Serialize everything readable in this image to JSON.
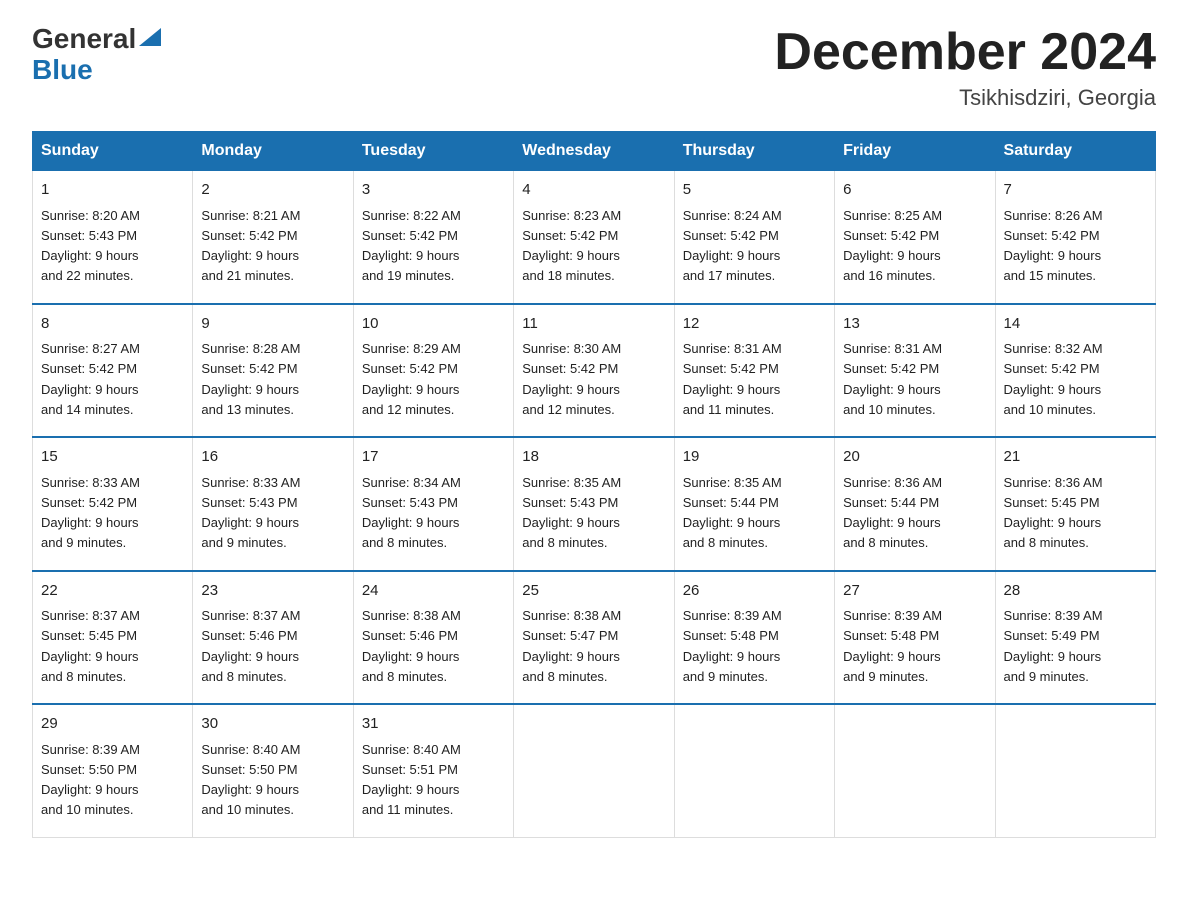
{
  "logo": {
    "general": "General",
    "blue": "Blue"
  },
  "title": "December 2024",
  "subtitle": "Tsikhisdziri, Georgia",
  "days_header": [
    "Sunday",
    "Monday",
    "Tuesday",
    "Wednesday",
    "Thursday",
    "Friday",
    "Saturday"
  ],
  "weeks": [
    [
      {
        "day": "1",
        "info": "Sunrise: 8:20 AM\nSunset: 5:43 PM\nDaylight: 9 hours\nand 22 minutes."
      },
      {
        "day": "2",
        "info": "Sunrise: 8:21 AM\nSunset: 5:42 PM\nDaylight: 9 hours\nand 21 minutes."
      },
      {
        "day": "3",
        "info": "Sunrise: 8:22 AM\nSunset: 5:42 PM\nDaylight: 9 hours\nand 19 minutes."
      },
      {
        "day": "4",
        "info": "Sunrise: 8:23 AM\nSunset: 5:42 PM\nDaylight: 9 hours\nand 18 minutes."
      },
      {
        "day": "5",
        "info": "Sunrise: 8:24 AM\nSunset: 5:42 PM\nDaylight: 9 hours\nand 17 minutes."
      },
      {
        "day": "6",
        "info": "Sunrise: 8:25 AM\nSunset: 5:42 PM\nDaylight: 9 hours\nand 16 minutes."
      },
      {
        "day": "7",
        "info": "Sunrise: 8:26 AM\nSunset: 5:42 PM\nDaylight: 9 hours\nand 15 minutes."
      }
    ],
    [
      {
        "day": "8",
        "info": "Sunrise: 8:27 AM\nSunset: 5:42 PM\nDaylight: 9 hours\nand 14 minutes."
      },
      {
        "day": "9",
        "info": "Sunrise: 8:28 AM\nSunset: 5:42 PM\nDaylight: 9 hours\nand 13 minutes."
      },
      {
        "day": "10",
        "info": "Sunrise: 8:29 AM\nSunset: 5:42 PM\nDaylight: 9 hours\nand 12 minutes."
      },
      {
        "day": "11",
        "info": "Sunrise: 8:30 AM\nSunset: 5:42 PM\nDaylight: 9 hours\nand 12 minutes."
      },
      {
        "day": "12",
        "info": "Sunrise: 8:31 AM\nSunset: 5:42 PM\nDaylight: 9 hours\nand 11 minutes."
      },
      {
        "day": "13",
        "info": "Sunrise: 8:31 AM\nSunset: 5:42 PM\nDaylight: 9 hours\nand 10 minutes."
      },
      {
        "day": "14",
        "info": "Sunrise: 8:32 AM\nSunset: 5:42 PM\nDaylight: 9 hours\nand 10 minutes."
      }
    ],
    [
      {
        "day": "15",
        "info": "Sunrise: 8:33 AM\nSunset: 5:42 PM\nDaylight: 9 hours\nand 9 minutes."
      },
      {
        "day": "16",
        "info": "Sunrise: 8:33 AM\nSunset: 5:43 PM\nDaylight: 9 hours\nand 9 minutes."
      },
      {
        "day": "17",
        "info": "Sunrise: 8:34 AM\nSunset: 5:43 PM\nDaylight: 9 hours\nand 8 minutes."
      },
      {
        "day": "18",
        "info": "Sunrise: 8:35 AM\nSunset: 5:43 PM\nDaylight: 9 hours\nand 8 minutes."
      },
      {
        "day": "19",
        "info": "Sunrise: 8:35 AM\nSunset: 5:44 PM\nDaylight: 9 hours\nand 8 minutes."
      },
      {
        "day": "20",
        "info": "Sunrise: 8:36 AM\nSunset: 5:44 PM\nDaylight: 9 hours\nand 8 minutes."
      },
      {
        "day": "21",
        "info": "Sunrise: 8:36 AM\nSunset: 5:45 PM\nDaylight: 9 hours\nand 8 minutes."
      }
    ],
    [
      {
        "day": "22",
        "info": "Sunrise: 8:37 AM\nSunset: 5:45 PM\nDaylight: 9 hours\nand 8 minutes."
      },
      {
        "day": "23",
        "info": "Sunrise: 8:37 AM\nSunset: 5:46 PM\nDaylight: 9 hours\nand 8 minutes."
      },
      {
        "day": "24",
        "info": "Sunrise: 8:38 AM\nSunset: 5:46 PM\nDaylight: 9 hours\nand 8 minutes."
      },
      {
        "day": "25",
        "info": "Sunrise: 8:38 AM\nSunset: 5:47 PM\nDaylight: 9 hours\nand 8 minutes."
      },
      {
        "day": "26",
        "info": "Sunrise: 8:39 AM\nSunset: 5:48 PM\nDaylight: 9 hours\nand 9 minutes."
      },
      {
        "day": "27",
        "info": "Sunrise: 8:39 AM\nSunset: 5:48 PM\nDaylight: 9 hours\nand 9 minutes."
      },
      {
        "day": "28",
        "info": "Sunrise: 8:39 AM\nSunset: 5:49 PM\nDaylight: 9 hours\nand 9 minutes."
      }
    ],
    [
      {
        "day": "29",
        "info": "Sunrise: 8:39 AM\nSunset: 5:50 PM\nDaylight: 9 hours\nand 10 minutes."
      },
      {
        "day": "30",
        "info": "Sunrise: 8:40 AM\nSunset: 5:50 PM\nDaylight: 9 hours\nand 10 minutes."
      },
      {
        "day": "31",
        "info": "Sunrise: 8:40 AM\nSunset: 5:51 PM\nDaylight: 9 hours\nand 11 minutes."
      },
      {
        "day": "",
        "info": ""
      },
      {
        "day": "",
        "info": ""
      },
      {
        "day": "",
        "info": ""
      },
      {
        "day": "",
        "info": ""
      }
    ]
  ]
}
